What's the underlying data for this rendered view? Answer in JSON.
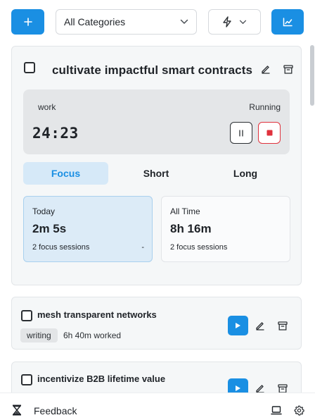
{
  "toolbar": {
    "add_icon": "plus-icon",
    "category_select": {
      "value": "All Categories",
      "icon": "chevron-down-icon"
    },
    "filter_icon": "lightning-bolt-icon",
    "stats_icon": "line-chart-icon"
  },
  "active_task": {
    "title": "cultivate impactful smart contracts",
    "timer": {
      "tag": "work",
      "status": "Running",
      "time": "24:23"
    },
    "modes": [
      "Focus",
      "Short",
      "Long"
    ],
    "active_mode": "Focus",
    "stats": {
      "today": {
        "label": "Today",
        "value": "2m 5s",
        "sessions": "2 focus sessions",
        "extra": "-"
      },
      "all_time": {
        "label": "All Time",
        "value": "8h 16m",
        "sessions": "2 focus sessions"
      }
    }
  },
  "tasks": [
    {
      "title": "mesh transparent networks",
      "tag": "writing",
      "worked": "6h 40m worked"
    },
    {
      "title": "incentivize B2B lifetime value"
    }
  ],
  "footer": {
    "feedback_label": "Feedback",
    "logo_icon": "hourglass-icon",
    "laptop_icon": "laptop-icon",
    "settings_icon": "gear-icon"
  },
  "colors": {
    "accent": "#1a8fe3",
    "stop": "#e0323d"
  }
}
